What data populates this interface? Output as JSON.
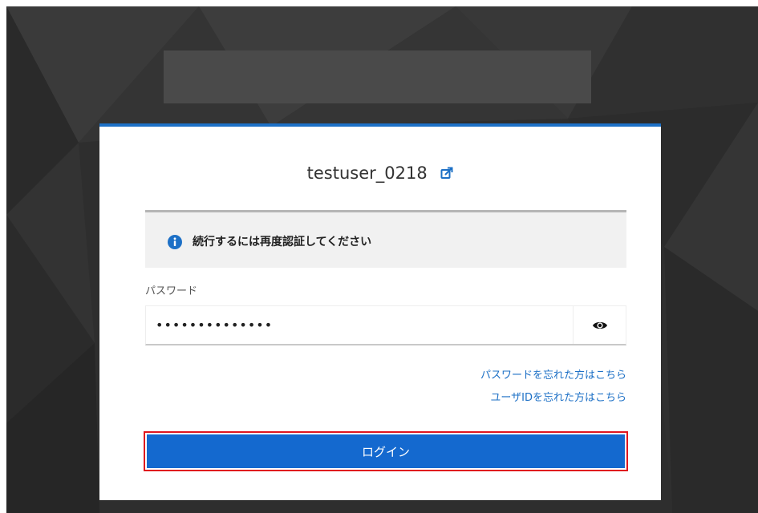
{
  "theme": {
    "accent": "#1d70c6",
    "button_bg": "#1469cf",
    "highlight_border": "#e0161e",
    "background": "#2f2f2f",
    "card_bg": "#ffffff",
    "alert_bg": "#f1f1f1"
  },
  "header": {
    "username": "testuser_0218",
    "reset_user_icon": "external-link-icon"
  },
  "alert": {
    "icon": "info-icon",
    "message": "続行するには再度認証してください"
  },
  "password": {
    "label": "パスワード",
    "value": "••••••••••••••",
    "toggle_icon": "eye-icon"
  },
  "links": {
    "forgot_password": "パスワードを忘れた方はこちら",
    "forgot_userid": "ユーザIDを忘れた方はこちら"
  },
  "login": {
    "label": "ログイン"
  }
}
